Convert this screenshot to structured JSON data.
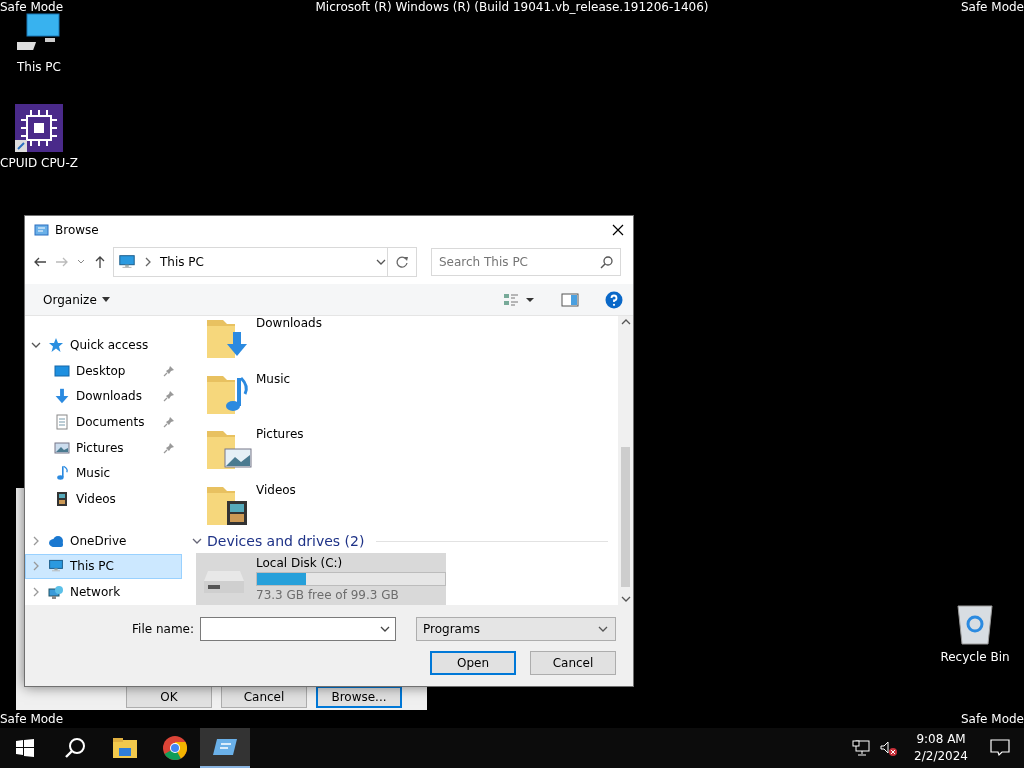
{
  "desktop": {
    "safe_mode_labels": [
      "Safe Mode",
      "Safe Mode",
      "Safe Mode",
      "Safe Mode"
    ],
    "build_text": "Microsoft (R) Windows (R) (Build 19041.vb_release.191206-1406)",
    "icons": [
      {
        "label": "This PC",
        "kind": "computer"
      },
      {
        "label": "CPUID CPU-Z",
        "kind": "cpu"
      },
      {
        "label": "Recycle Bin",
        "kind": "recycle"
      }
    ]
  },
  "back_dialog": {
    "buttons": [
      {
        "label": "OK",
        "default": false
      },
      {
        "label": "Cancel",
        "default": false
      },
      {
        "label": "Browse...",
        "default": true
      }
    ]
  },
  "dialog": {
    "title": "Browse",
    "address": "This PC",
    "search_placeholder": "Search This PC",
    "organize": "Organize",
    "nav_tree": [
      {
        "label": "Quick access",
        "kind": "star",
        "expanded": true,
        "selected": false,
        "children": [
          {
            "label": "Desktop",
            "kind": "desktop",
            "pinned": true,
            "selected": false
          },
          {
            "label": "Downloads",
            "kind": "downloads",
            "pinned": true,
            "selected": false
          },
          {
            "label": "Documents",
            "kind": "documents",
            "pinned": true,
            "selected": false
          },
          {
            "label": "Pictures",
            "kind": "pictures",
            "pinned": true,
            "selected": false
          },
          {
            "label": "Music",
            "kind": "music",
            "pinned": false,
            "selected": false
          },
          {
            "label": "Videos",
            "kind": "videos",
            "pinned": false,
            "selected": false
          }
        ]
      },
      {
        "label": "OneDrive",
        "kind": "cloud",
        "expanded": false,
        "selected": false
      },
      {
        "label": "This PC",
        "kind": "computer",
        "expanded": false,
        "selected": true
      },
      {
        "label": "Network",
        "kind": "network",
        "expanded": false,
        "selected": false
      }
    ],
    "folders": [
      {
        "label": "Downloads",
        "kind": "downloads"
      },
      {
        "label": "Music",
        "kind": "music"
      },
      {
        "label": "Pictures",
        "kind": "pictures"
      },
      {
        "label": "Videos",
        "kind": "videos"
      }
    ],
    "group": {
      "title": "Devices and drives (2)",
      "expanded": true
    },
    "drives": [
      {
        "name": "Local Disk (C:)",
        "level": 0.26,
        "free": "73.3 GB free of 99.3 GB",
        "selected": true
      }
    ],
    "file_name_label": "File name:",
    "file_type": "Programs",
    "buttons": [
      {
        "label": "Open",
        "default": true
      },
      {
        "label": "Cancel",
        "default": false
      }
    ]
  },
  "taskbar": {
    "items": [
      {
        "kind": "start",
        "active": false
      },
      {
        "kind": "search",
        "active": false
      },
      {
        "kind": "explorer",
        "active": false
      },
      {
        "kind": "chrome",
        "active": false
      },
      {
        "kind": "app",
        "active": true
      }
    ],
    "clock": {
      "time": "9:08 AM",
      "date": "2/2/2024"
    }
  }
}
